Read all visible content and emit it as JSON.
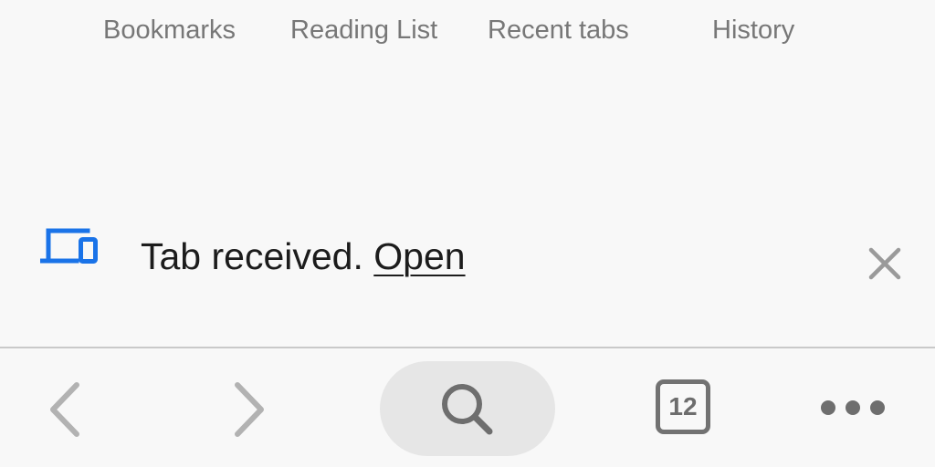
{
  "top_tabs": {
    "bookmarks": "Bookmarks",
    "reading_list": "Reading List",
    "recent_tabs": "Recent tabs",
    "history": "History"
  },
  "snackbar": {
    "message": "Tab received.",
    "action": "Open",
    "icon": "devices-icon",
    "accent_color": "#1a73e8"
  },
  "toolbar": {
    "back_icon": "back-arrow-icon",
    "forward_icon": "forward-arrow-icon",
    "search_icon": "search-icon",
    "tab_count": "12",
    "menu_icon": "more-icon"
  }
}
